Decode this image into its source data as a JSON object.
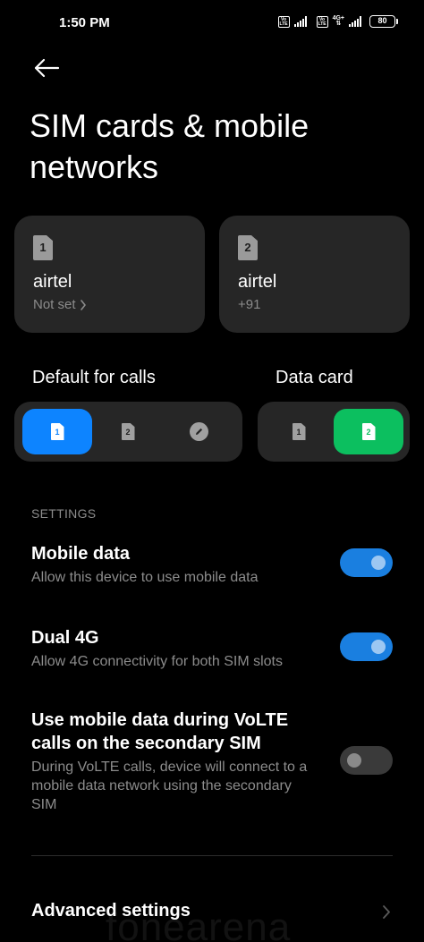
{
  "status_bar": {
    "time": "1:50 PM",
    "volte_label": "Vo LTE",
    "network_type": "4G+",
    "battery": "80"
  },
  "header": {
    "title": "SIM cards & mobile networks"
  },
  "sim_cards": [
    {
      "slot": "1",
      "carrier": "airtel",
      "detail": "Not set"
    },
    {
      "slot": "2",
      "carrier": "airtel",
      "detail": "+91"
    }
  ],
  "default_calls": {
    "label": "Default for calls",
    "options": [
      "1",
      "2"
    ],
    "selected": "1"
  },
  "data_card": {
    "label": "Data card",
    "options": [
      "1",
      "2"
    ],
    "selected": "2"
  },
  "settings": {
    "section_label": "SETTINGS",
    "items": [
      {
        "title": "Mobile data",
        "description": "Allow this device to use mobile data",
        "enabled": true
      },
      {
        "title": "Dual 4G",
        "description": "Allow 4G connectivity for both SIM slots",
        "enabled": true
      },
      {
        "title": "Use mobile data during VoLTE calls on the secondary SIM",
        "description": "During VoLTE calls, device will connect to a mobile data network using the secondary SIM",
        "enabled": false
      }
    ]
  },
  "advanced": {
    "title": "Advanced settings"
  },
  "watermark": "fonearena",
  "colors": {
    "background": "#000000",
    "card": "#262626",
    "accent_blue": "#0d84ff",
    "accent_green": "#0cbf5f",
    "toggle_on": "#1a7fe0",
    "toggle_off": "#3a3a3a",
    "secondary_text": "#8c8c8c"
  },
  "icons": {
    "back": "arrow-left-icon",
    "sim": "sim-card-icon",
    "edit": "pencil-icon",
    "chevron": "chevron-right-icon"
  }
}
